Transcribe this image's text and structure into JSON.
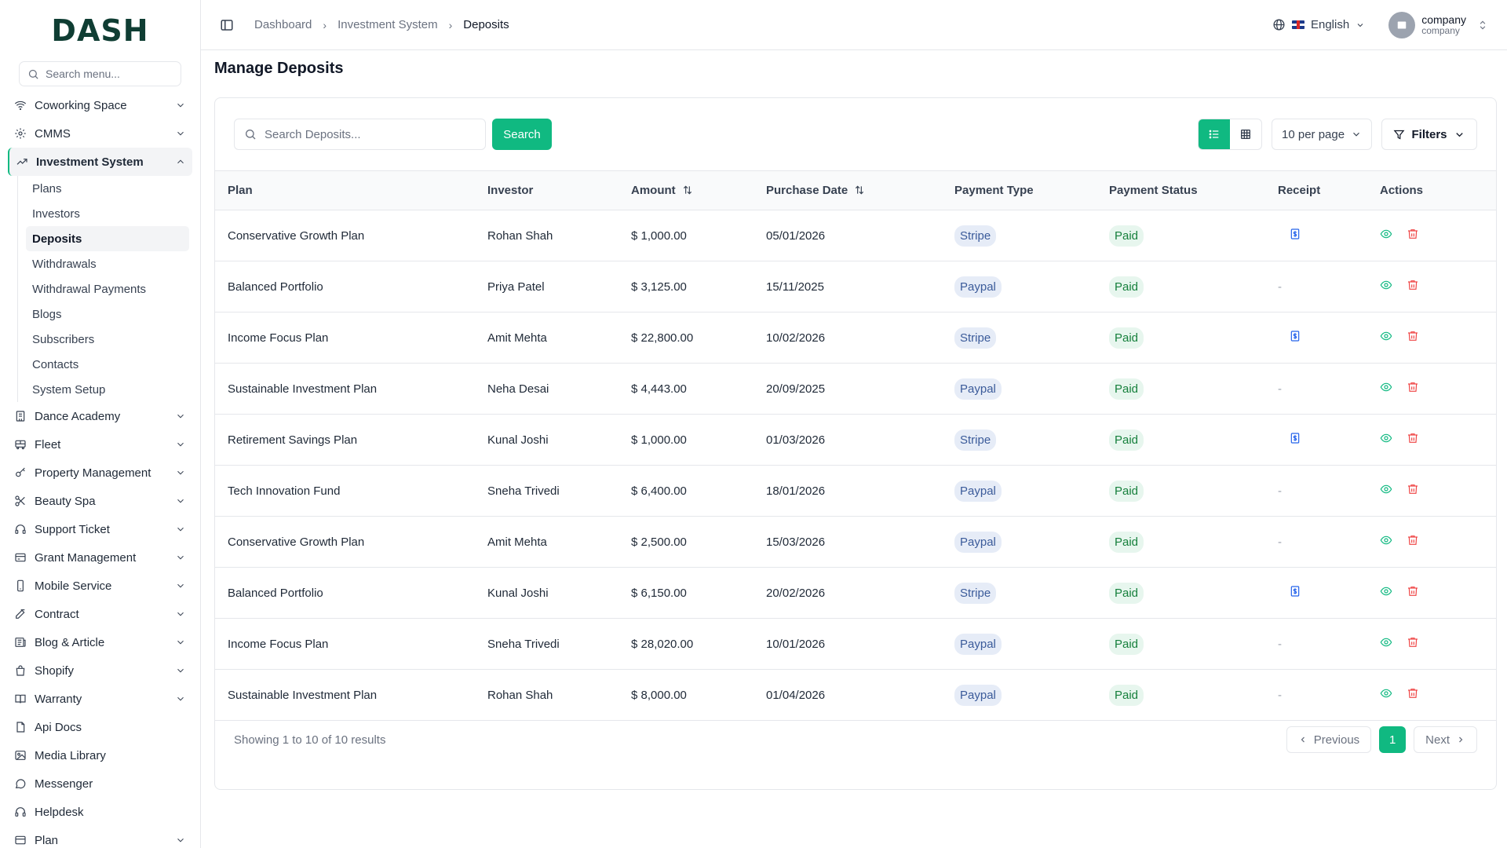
{
  "brand": {
    "logo_main": "DASH",
    "accent_color": "#10b981"
  },
  "sidebar": {
    "search_placeholder": "Search menu...",
    "items": [
      {
        "label": "Coworking Space",
        "icon": "wifi-icon",
        "has_chevron": true
      },
      {
        "label": "CMMS",
        "icon": "gear-icon",
        "has_chevron": true
      },
      {
        "label": "Investment System",
        "icon": "trending-up-icon",
        "has_chevron": true,
        "expanded": true
      },
      {
        "label": "Dance Academy",
        "icon": "building-icon",
        "has_chevron": true
      },
      {
        "label": "Fleet",
        "icon": "bus-icon",
        "has_chevron": true
      },
      {
        "label": "Property Management",
        "icon": "key-icon",
        "has_chevron": true
      },
      {
        "label": "Beauty Spa",
        "icon": "scissors-icon",
        "has_chevron": true
      },
      {
        "label": "Support Ticket",
        "icon": "headphones-icon",
        "has_chevron": true
      },
      {
        "label": "Grant Management",
        "icon": "card-icon",
        "has_chevron": true
      },
      {
        "label": "Mobile Service",
        "icon": "phone-icon",
        "has_chevron": true
      },
      {
        "label": "Contract",
        "icon": "edit-icon",
        "has_chevron": true
      },
      {
        "label": "Blog & Article",
        "icon": "newspaper-icon",
        "has_chevron": true
      },
      {
        "label": "Shopify",
        "icon": "bag-icon",
        "has_chevron": true
      },
      {
        "label": "Warranty",
        "icon": "book-icon",
        "has_chevron": true
      },
      {
        "label": "Api Docs",
        "icon": "doc-icon",
        "has_chevron": false
      },
      {
        "label": "Media Library",
        "icon": "image-icon",
        "has_chevron": false
      },
      {
        "label": "Messenger",
        "icon": "chat-icon",
        "has_chevron": false
      },
      {
        "label": "Helpdesk",
        "icon": "headset-icon",
        "has_chevron": false
      },
      {
        "label": "Plan",
        "icon": "credit-card-icon",
        "has_chevron": true
      }
    ],
    "submenu": [
      "Plans",
      "Investors",
      "Deposits",
      "Withdrawals",
      "Withdrawal Payments",
      "Blogs",
      "Subscribers",
      "Contacts",
      "System Setup"
    ],
    "active_sub": "Deposits"
  },
  "topbar": {
    "breadcrumb": [
      "Dashboard",
      "Investment System",
      "Deposits"
    ],
    "language": "English",
    "user_name": "company",
    "user_role": "company"
  },
  "page": {
    "title": "Manage Deposits"
  },
  "toolbar": {
    "search_placeholder": "Search Deposits...",
    "search_button": "Search",
    "per_page": "10 per page",
    "filters_label": "Filters"
  },
  "table": {
    "columns": [
      "Plan",
      "Investor",
      "Amount",
      "Purchase Date",
      "Payment Type",
      "Payment Status",
      "Receipt",
      "Actions"
    ],
    "rows": [
      {
        "plan": "Conservative Growth Plan",
        "investor": "Rohan Shah",
        "amount": "$ 1,000.00",
        "date": "05/01/2026",
        "type": "Stripe",
        "status": "Paid",
        "receipt": true
      },
      {
        "plan": "Balanced Portfolio",
        "investor": "Priya Patel",
        "amount": "$ 3,125.00",
        "date": "15/11/2025",
        "type": "Paypal",
        "status": "Paid",
        "receipt": false
      },
      {
        "plan": "Income Focus Plan",
        "investor": "Amit Mehta",
        "amount": "$ 22,800.00",
        "date": "10/02/2026",
        "type": "Stripe",
        "status": "Paid",
        "receipt": true
      },
      {
        "plan": "Sustainable Investment Plan",
        "investor": "Neha Desai",
        "amount": "$ 4,443.00",
        "date": "20/09/2025",
        "type": "Paypal",
        "status": "Paid",
        "receipt": false
      },
      {
        "plan": "Retirement Savings Plan",
        "investor": "Kunal Joshi",
        "amount": "$ 1,000.00",
        "date": "01/03/2026",
        "type": "Stripe",
        "status": "Paid",
        "receipt": true
      },
      {
        "plan": "Tech Innovation Fund",
        "investor": "Sneha Trivedi",
        "amount": "$ 6,400.00",
        "date": "18/01/2026",
        "type": "Paypal",
        "status": "Paid",
        "receipt": false
      },
      {
        "plan": "Conservative Growth Plan",
        "investor": "Amit Mehta",
        "amount": "$ 2,500.00",
        "date": "15/03/2026",
        "type": "Paypal",
        "status": "Paid",
        "receipt": false
      },
      {
        "plan": "Balanced Portfolio",
        "investor": "Kunal Joshi",
        "amount": "$ 6,150.00",
        "date": "20/02/2026",
        "type": "Stripe",
        "status": "Paid",
        "receipt": true
      },
      {
        "plan": "Income Focus Plan",
        "investor": "Sneha Trivedi",
        "amount": "$ 28,020.00",
        "date": "10/01/2026",
        "type": "Paypal",
        "status": "Paid",
        "receipt": false
      },
      {
        "plan": "Sustainable Investment Plan",
        "investor": "Rohan Shah",
        "amount": "$ 8,000.00",
        "date": "01/04/2026",
        "type": "Paypal",
        "status": "Paid",
        "receipt": false
      }
    ],
    "empty_receipt": "-"
  },
  "pagination": {
    "summary": "Showing 1 to 10 of 10 results",
    "previous": "Previous",
    "next": "Next",
    "current_page": "1"
  }
}
